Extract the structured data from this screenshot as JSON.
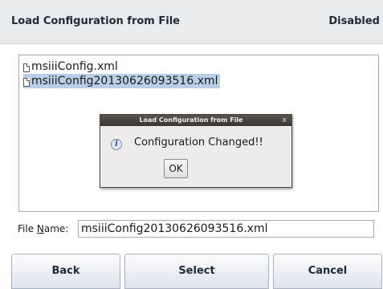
{
  "header": {
    "title": "Load Configuration from File",
    "status": "Disabled"
  },
  "file_list": {
    "items": [
      {
        "name": "msiiiConfig.xml",
        "selected": false
      },
      {
        "name": "msiiiConfig20130626093516.xml",
        "selected": true
      }
    ]
  },
  "dialog": {
    "title": "Load Configuration from File",
    "close_glyph": "x",
    "icon": "info-icon",
    "icon_glyph": "i",
    "message": "Configuration Changed!!",
    "ok_label": "OK"
  },
  "file_name": {
    "label_prefix": "File ",
    "label_mnemonic": "N",
    "label_suffix": "ame:",
    "value": "msiiiConfig20130626093516.xml"
  },
  "buttons": {
    "back": "Back",
    "select": "Select",
    "cancel": "Cancel"
  },
  "colors": {
    "header_bg": "#e8ecef",
    "selection": "#b9cfe8",
    "dialog_titlebar": "#3b3632"
  }
}
